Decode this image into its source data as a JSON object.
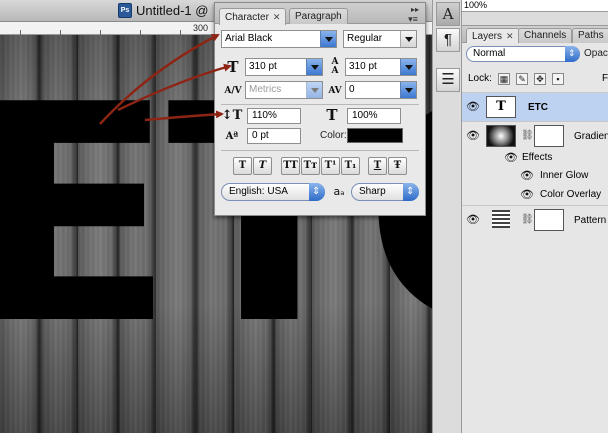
{
  "document": {
    "title": "Untitled-1 @",
    "app_badge": "Ps",
    "ruler_label": "300",
    "canvas_text": "ETC"
  },
  "character_panel": {
    "tabs": [
      {
        "label": "Character",
        "close": "✕",
        "active": true
      },
      {
        "label": "Paragraph",
        "active": false
      }
    ],
    "collapse_glyph": "▸▸",
    "menu_glyph": "▾≡",
    "font_family": "Arial Black",
    "font_style": "Regular",
    "font_size": "310 pt",
    "leading": "310 pt",
    "kerning": "Metrics",
    "tracking": "0",
    "vertical_scale": "110%",
    "horizontal_scale": "100%",
    "baseline_shift": "0 pt",
    "color_label": "Color:",
    "text_color": "#000000",
    "style_buttons": [
      "T",
      "T",
      "TT",
      "Tт",
      "T¹",
      "T₁",
      "T",
      "Ŧ"
    ],
    "language": "English: USA",
    "aa_icon": "aₐ",
    "antialias": "Sharp"
  },
  "tools": {
    "type_tool": "A",
    "paragraph": "¶",
    "notes": "☰"
  },
  "layers_panel": {
    "opacity_value": "100%",
    "tabs": [
      {
        "label": "Layers",
        "close": "✕",
        "active": true
      },
      {
        "label": "Channels",
        "active": false
      },
      {
        "label": "Paths",
        "active": false
      }
    ],
    "blend_mode": "Normal",
    "opacity_label": "Opaci",
    "lock_label": "Lock:",
    "fill_label": "F",
    "layers": [
      {
        "name": "ETC",
        "thumb": "T",
        "selected": true
      },
      {
        "name": "Gradien",
        "has_mask": true
      },
      {
        "name": "Effects"
      },
      {
        "name": "Inner Glow"
      },
      {
        "name": "Color Overlay"
      },
      {
        "name": "Pattern",
        "has_mask": true
      }
    ]
  },
  "colors": {
    "arrow": "#8e2414",
    "selected_row": "#bcd2f0"
  }
}
